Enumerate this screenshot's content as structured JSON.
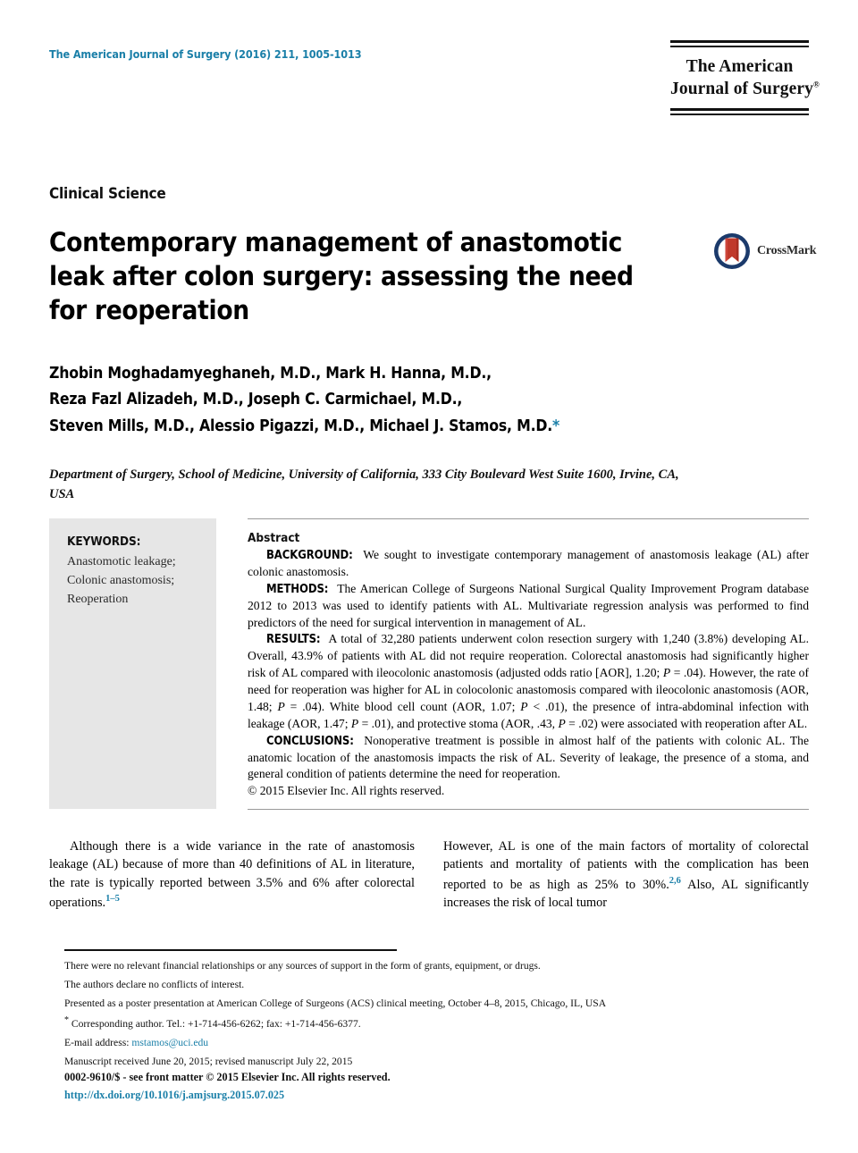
{
  "header": {
    "journal_reference": "The American Journal of Surgery (2016) 211, 1005-1013",
    "logo_line1": "The American",
    "logo_line2": "Journal of Surgery",
    "logo_superscript": "®",
    "accent_color": "#1a7fa8"
  },
  "article": {
    "section_label": "Clinical Science",
    "title_line1": "Contemporary management of anastomotic",
    "title_line2": "leak after colon surgery: assessing the need",
    "title_line3": "for reoperation",
    "authors_line1": "Zhobin Moghadamyeghaneh, M.D., Mark H. Hanna, M.D.,",
    "authors_line2": "Reza Fazl Alizadeh, M.D., Joseph C. Carmichael, M.D.,",
    "authors_line3": "Steven Mills, M.D., Alessio Pigazzi, M.D., Michael J. Stamos, M.D.",
    "corresponding_marker": "*",
    "affiliation": "Department of Surgery, School of Medicine, University of California, 333 City Boulevard West Suite 1600, Irvine, CA, USA"
  },
  "crossmark": {
    "label": "CrossMark",
    "ring_color": "#1b3a6b",
    "banner_color": "#c0392b"
  },
  "keywords": {
    "heading": "KEYWORDS:",
    "items": [
      "Anastomotic leakage;",
      "Colonic anastomosis;",
      "Reoperation"
    ]
  },
  "abstract": {
    "heading": "Abstract",
    "sections": [
      {
        "label": "BACKGROUND:",
        "text": "We sought to investigate contemporary management of anastomosis leakage (AL) after colonic anastomosis."
      },
      {
        "label": "METHODS:",
        "text": "The American College of Surgeons National Surgical Quality Improvement Program database 2012 to 2013 was used to identify patients with AL. Multivariate regression analysis was performed to find predictors of the need for surgical intervention in management of AL."
      },
      {
        "label": "RESULTS:",
        "text_part1": "A total of 32,280 patients underwent colon resection surgery with 1,240 (3.8%) developing AL. Overall, 43.9% of patients with AL did not require reoperation. Colorectal anastomosis had significantly higher risk of AL compared with ileocolonic anastomosis (adjusted odds ratio [AOR], 1.20; ",
        "p1": "P",
        "text_part2": " = .04). However, the rate of need for reoperation was higher for AL in colocolonic anastomosis compared with ileocolonic anastomosis (AOR, 1.48; ",
        "p2": "P",
        "text_part3": " = .04). White blood cell count (AOR, 1.07; ",
        "p3": "P",
        "text_part4": " < .01), the presence of intra-abdominal infection with leakage (AOR, 1.47; ",
        "p4": "P",
        "text_part5": " = .01), and protective stoma (AOR, .43, ",
        "p5": "P",
        "text_part6": " = .02) were associated with reoperation after AL."
      },
      {
        "label": "CONCLUSIONS:",
        "text": "Nonoperative treatment is possible in almost half of the patients with colonic AL. The anatomic location of the anastomosis impacts the risk of AL. Severity of leakage, the presence of a stoma, and general condition of patients determine the need for reoperation."
      }
    ],
    "copyright": "© 2015 Elsevier Inc. All rights reserved."
  },
  "body": {
    "left_column_text": "Although there is a wide variance in the rate of anastomosis leakage (AL) because of more than 40 definitions of AL in literature, the rate is typically reported between 3.5% and 6% after colorectal operations.",
    "left_column_citation": "1–5",
    "right_column_text": "However, AL is one of the main factors of mortality of colorectal patients and mortality of patients with the complication has been reported to be as high as 25% to 30%.",
    "right_column_citation": "2,6",
    "right_column_text2": "Also, AL significantly increases the risk of local tumor"
  },
  "footnotes": {
    "line1": "There were no relevant financial relationships or any sources of support in the form of grants, equipment, or drugs.",
    "line2": "The authors declare no conflicts of interest.",
    "line3": "Presented as a poster presentation at American College of Surgeons (ACS) clinical meeting, October 4–8, 2015, Chicago, IL, USA",
    "line4_marker": "*",
    "line4": "Corresponding author. Tel.: +1-714-456-6262; fax: +1-714-456-6377.",
    "line5_label": "E-mail address:",
    "line5_email": "mstamos@uci.edu",
    "line6": "Manuscript received June 20, 2015; revised manuscript July 22, 2015"
  },
  "imprint": {
    "line1": "0002-9610/$ - see front matter © 2015 Elsevier Inc. All rights reserved.",
    "doi": "http://dx.doi.org/10.1016/j.amjsurg.2015.07.025"
  }
}
